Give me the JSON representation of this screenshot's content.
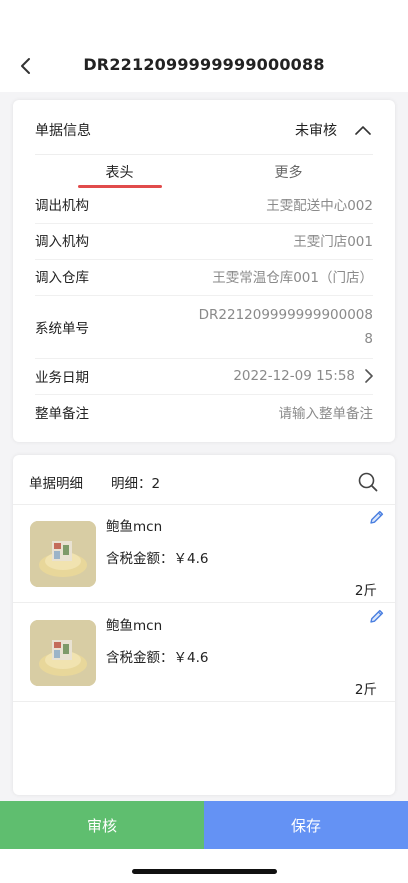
{
  "header": {
    "title": "DR2212099999999000088"
  },
  "info": {
    "label": "单据信息",
    "status": "未审核",
    "tabs": [
      {
        "label": "表头",
        "active": true
      },
      {
        "label": "更多",
        "active": false
      }
    ],
    "fields": [
      {
        "label": "调出机构",
        "value": "王雯配送中心002"
      },
      {
        "label": "调入机构",
        "value": "王雯门店001"
      },
      {
        "label": "调入仓库",
        "value": "王雯常温仓库001（门店）"
      },
      {
        "label": "系统单号",
        "value_line1": "DR221209999999900008",
        "value_line2": "8"
      },
      {
        "label": "业务日期",
        "value": "2022-12-09 15:58"
      },
      {
        "label": "整单备注",
        "placeholder": "请输入整单备注"
      }
    ]
  },
  "details": {
    "title": "单据明细",
    "count_label": "明细：2",
    "items": [
      {
        "name": "鲍鱼mcn",
        "price": "含税金额：￥4.6",
        "qty": "2斤"
      },
      {
        "name": "鲍鱼mcn",
        "price": "含税金额：￥4.6",
        "qty": "2斤"
      }
    ]
  },
  "actions": {
    "review_label": "审核",
    "save_label": "保存"
  },
  "colors": {
    "accent_red": "#e14b4b",
    "review_green": "#5fbe6f",
    "save_blue": "#6492f4"
  }
}
